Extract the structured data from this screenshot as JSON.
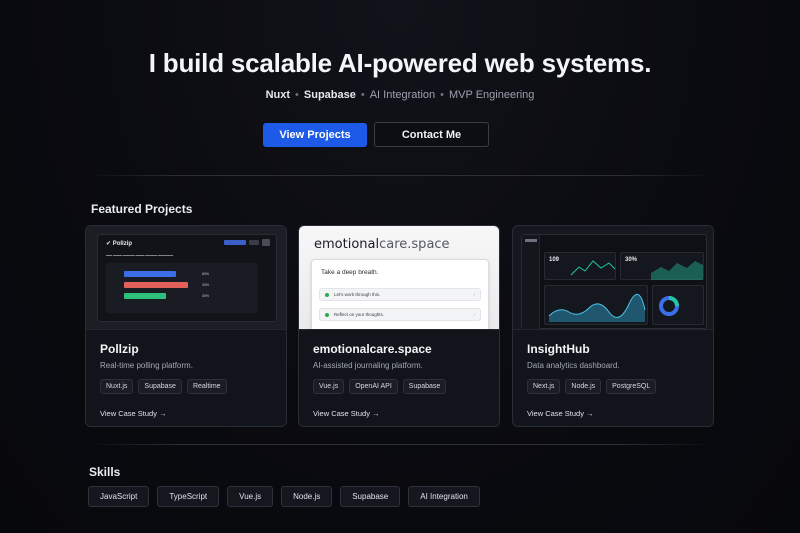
{
  "hero": {
    "headline": "I build scalable AI-powered web systems.",
    "tagline": [
      {
        "text": "Nuxt",
        "emphasis": true
      },
      {
        "text": "Supabase",
        "emphasis": true
      },
      {
        "text": "AI Integration",
        "emphasis": false
      },
      {
        "text": "MVP Engineering",
        "emphasis": false
      }
    ],
    "primary_button": "View Projects",
    "secondary_button": "Contact Me"
  },
  "featured": {
    "heading": "Featured Projects",
    "projects": [
      {
        "title": "Pollzip",
        "description": "Real-time polling platform.",
        "tags": [
          "Nuxt.js",
          "Supabase",
          "Realtime"
        ],
        "link": "View Case Study →",
        "thumbnail": {
          "logo": "Pollzip",
          "poll_bars": [
            {
              "percent": 60,
              "color": "#3b6ee8"
            },
            {
              "percent": 30,
              "color": "#e2605a"
            },
            {
              "percent": 30,
              "color": "#2fbf7c"
            }
          ]
        }
      },
      {
        "title": "emotionalcare.space",
        "description": "AI-assisted journaling platform.",
        "tags": [
          "Vue.js",
          "OpenAI API",
          "Supabase"
        ],
        "link": "View Case Study →",
        "thumbnail": {
          "brand_bold": "emotional",
          "brand_light": "care.space",
          "prompt": "Take a deep breath.",
          "rows": [
            "Let’s work through this.",
            "Reflect on your thoughts."
          ]
        }
      },
      {
        "title": "InsightHub",
        "description": "Data analytics dashboard.",
        "tags": [
          "Next.js",
          "Node.js",
          "PostgreSQL"
        ],
        "link": "View Case Study →",
        "thumbnail": {
          "stats": [
            "109",
            "30%"
          ]
        }
      }
    ]
  },
  "skills": {
    "heading": "Skills",
    "items": [
      "JavaScript",
      "TypeScript",
      "Vue.js",
      "Node.js",
      "Supabase",
      "AI Integration"
    ]
  },
  "colors": {
    "accent": "#1d5ae8",
    "background": "#0a0b10",
    "card": "#12141b"
  }
}
